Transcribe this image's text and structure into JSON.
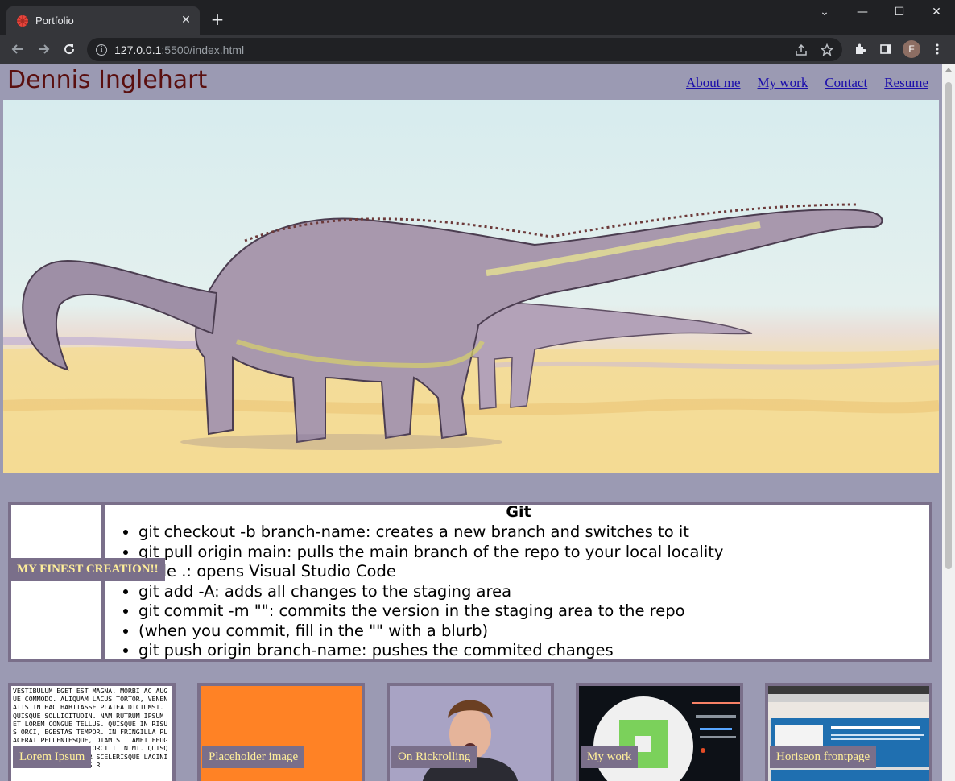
{
  "browser": {
    "tab_title": "Portfolio",
    "url_host": "127.0.0.1",
    "url_rest": ":5500/index.html",
    "profile_initial": "F"
  },
  "site": {
    "name": "Dennis Inglehart",
    "nav": [
      "About me",
      "My work",
      "Contact",
      "Resume"
    ]
  },
  "git": {
    "title": "Git",
    "items": [
      "git checkout -b branch-name: creates a new branch and switches to it",
      "git pull origin main: pulls the main branch of the repo to your local locality",
      "code .: opens Visual Studio Code",
      "git add -A: adds all changes to the staging area",
      "git commit -m \"\": commits the version in the staging area to the repo",
      "(when you commit, fill in the \"\" with a blurb)",
      "git push origin branch-name: pushes the commited changes"
    ],
    "badge": "MY FINEST CREATION!!"
  },
  "cards": [
    {
      "label": "Lorem Ipsum",
      "preview_text": "Vestibulum eget est magna. Morbi ac augue commodo. Aliquam lacus tortor, venenatis in hac habitasse platea dictumst. Quisque sollicitudin. Nam rutrum ipsum et lorem congue tellus. Quisque in risus orci, egestas tempor. In fringilla placerat pellentesque, diam sit amet feugiat f vehicula enim orci i in mi. Quisque lorem ipsum dolor scelerisque lacinia ipsum, eget varius r"
    },
    {
      "label": "Placeholder image"
    },
    {
      "label": "On Rickrolling"
    },
    {
      "label": "My work"
    },
    {
      "label": "Horiseon frontpage"
    }
  ],
  "colors": {
    "page_bg": "#9b9ab3",
    "accent": "#7a6f8a",
    "label_text": "#ffef9a",
    "title": "#5a0f0f",
    "placeholder_orange": "#ff8225"
  }
}
